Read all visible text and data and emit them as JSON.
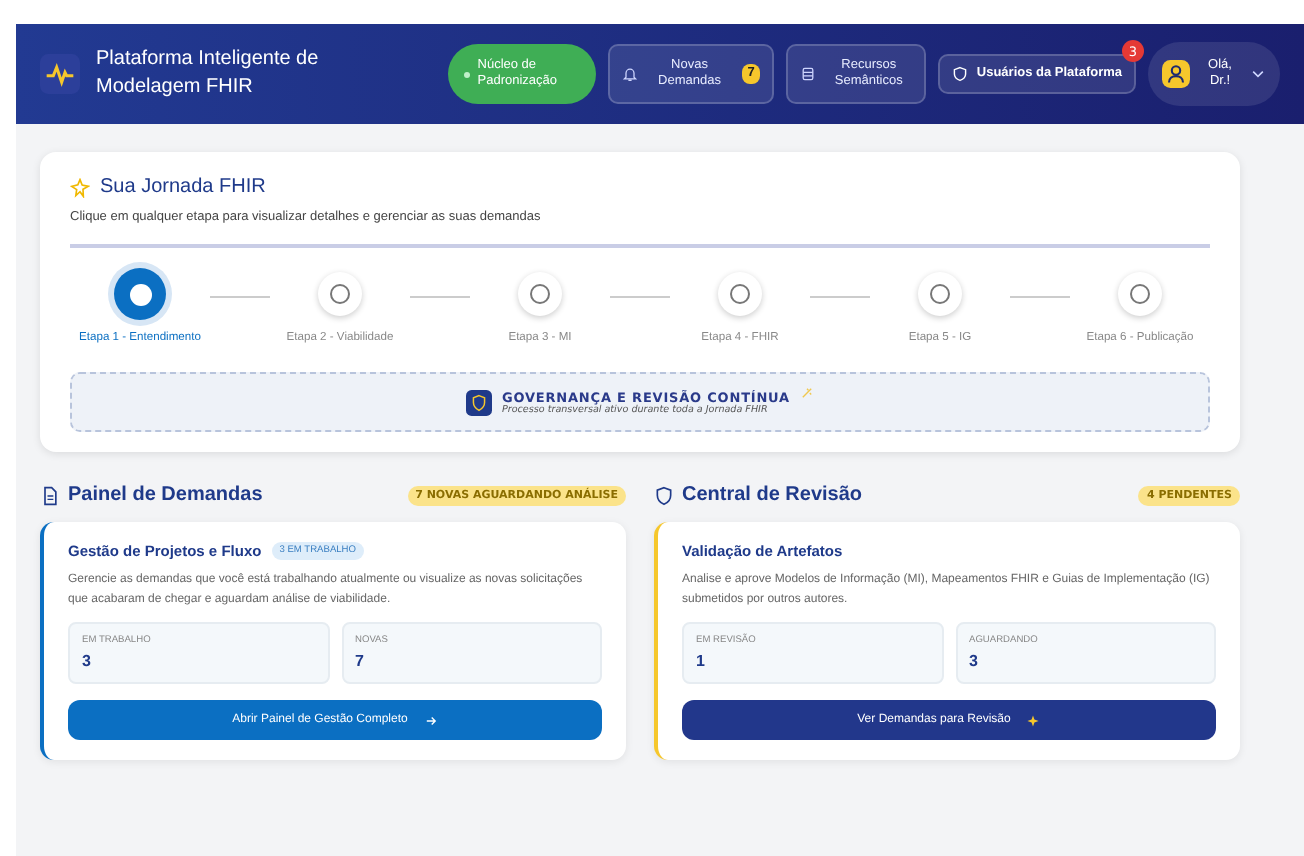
{
  "header": {
    "title": "Plataforma Inteligente de Modelagem FHIR",
    "nav": [
      {
        "kind": "status",
        "label": "Núcleo de Padronização"
      },
      {
        "kind": "bell",
        "label": "Novas Demandas",
        "badge": "7"
      },
      {
        "kind": "database",
        "label": "Recursos Semânticos"
      },
      {
        "kind": "shield",
        "label": "Usuários da Plataforma",
        "badge": "3"
      }
    ],
    "user": {
      "greeting": "Olá, Dr.!"
    }
  },
  "journey": {
    "title": "Sua Jornada FHIR",
    "subtitle": "Clique em qualquer etapa para visualizar detalhes e gerenciar as suas demandas",
    "steps": [
      {
        "label": "Etapa 1 - Entendimento",
        "selected": true
      },
      {
        "label": "Etapa 2 - Viabilidade",
        "selected": false
      },
      {
        "label": "Etapa 3 - MI",
        "selected": false
      },
      {
        "label": "Etapa 4 - FHIR",
        "selected": false
      },
      {
        "label": "Etapa 5 - IG",
        "selected": false
      },
      {
        "label": "Etapa 6 - Publicação",
        "selected": false
      }
    ],
    "governance": {
      "title": "GOVERNANÇA E REVISÃO CONTÍNUA",
      "subtitle": "Processo transversal ativo durante toda a Jornada FHIR"
    }
  },
  "panels": [
    {
      "kind": "demands",
      "title": "Painel de Demandas",
      "badge": "7 NOVAS AGUARDANDO ANÁLISE",
      "card_title": "Gestão de Projetos e Fluxo",
      "card_tag": "3 EM TRABALHO",
      "description": "Gerencie as demandas que você está trabalhando atualmente ou visualize as novas solicitações que acabaram de chegar e aguardam análise de viabilidade.",
      "stats": [
        {
          "label": "EM TRABALHO",
          "value": "3"
        },
        {
          "label": "NOVAS",
          "value": "7"
        }
      ],
      "button": "Abrir Painel de Gestão Completo"
    },
    {
      "kind": "review",
      "title": "Central de Revisão",
      "badge": "4 PENDENTES",
      "card_title": "Validação de Artefatos",
      "description": "Analise e aprove Modelos de Informação (MI), Mapeamentos FHIR e Guias de Implementação (IG) submetidos por outros autores.",
      "stats": [
        {
          "label": "EM REVISÃO",
          "value": "1"
        },
        {
          "label": "AGUARDANDO",
          "value": "3"
        }
      ],
      "button": "Ver Demandas para Revisão"
    }
  ]
}
